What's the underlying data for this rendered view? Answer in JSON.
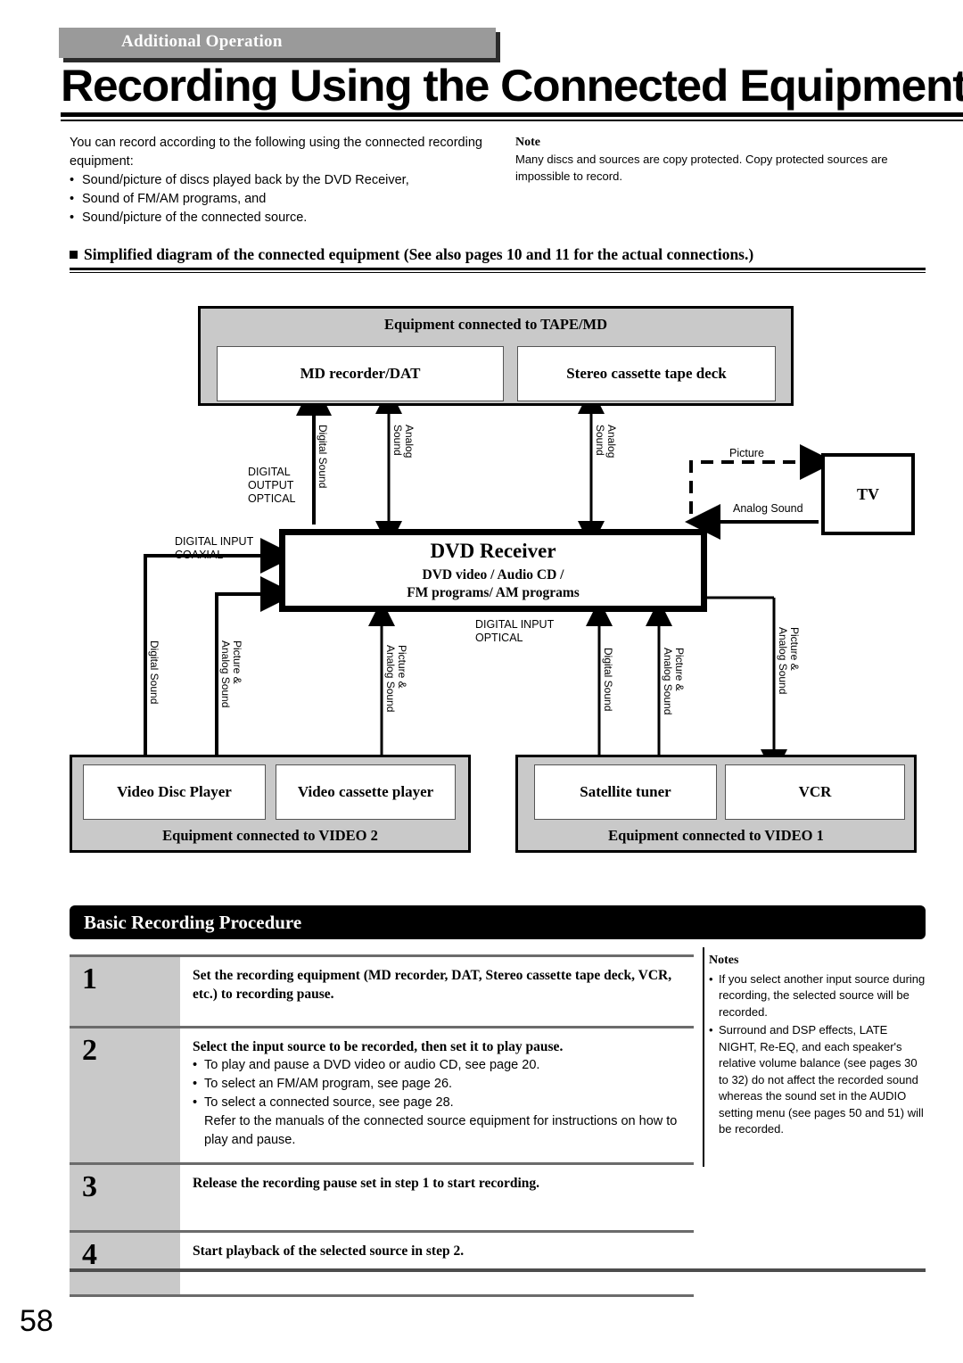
{
  "header": {
    "category_tab": "Additional Operation",
    "title": "Recording Using the Connected Equipment"
  },
  "intro": {
    "lead": "You can record according to the following using the connected recording equipment:",
    "bullets": [
      "Sound/picture of discs played back by the DVD Receiver,",
      "Sound of FM/AM programs, and",
      "Sound/picture of the connected source."
    ]
  },
  "note_top": {
    "heading": "Note",
    "text": "Many discs and sources are copy protected. Copy protected sources are impossible to record."
  },
  "section": {
    "heading": "Simplified diagram of the connected equipment (See also pages 10 and 11 for the actual connections.)"
  },
  "diagram": {
    "tape_md_group_title": "Equipment connected to TAPE/MD",
    "md_recorder": "MD recorder/DAT",
    "cassette_deck": "Stereo cassette tape deck",
    "receiver_name": "DVD Receiver",
    "receiver_sub_line1": "DVD video / Audio CD /",
    "receiver_sub_line2": "FM programs/ AM programs",
    "tv": "TV",
    "video2_group_title": "Equipment connected to VIDEO 2",
    "video_disc_player": "Video Disc Player",
    "video_cassette_player": "Video cassette player",
    "video1_group_title": "Equipment connected to VIDEO 1",
    "satellite_tuner": "Satellite tuner",
    "vcr": "VCR",
    "ports": {
      "digital_output_optical": "DIGITAL\nOUTPUT\nOPTICAL",
      "digital_input_coaxial": "DIGITAL INPUT\nCOAXIAL",
      "digital_input_optical": "DIGITAL INPUT\nOPTICAL"
    },
    "labels": {
      "digital_sound": "Digital Sound",
      "analog_sound_2line": "Analog\nSound",
      "picture": "Picture",
      "analog_sound": "Analog Sound",
      "picture_analog_2line": "Picture &\nAnalog Sound"
    }
  },
  "procedure": {
    "bar_title": "Basic Recording Procedure",
    "steps": [
      {
        "num": "1",
        "heading": "Set the recording equipment (MD recorder, DAT, Stereo cassette tape deck, VCR, etc.) to recording pause.",
        "bullets": [],
        "sub": ""
      },
      {
        "num": "2",
        "heading": "Select the input source to be recorded, then set it to play pause.",
        "bullets": [
          "To play and pause a DVD video or audio CD, see page 20.",
          "To select an FM/AM program, see page 26.",
          "To select a connected source, see page 28."
        ],
        "sub": "Refer to the manuals of the connected source equipment for instructions on how to play and pause."
      },
      {
        "num": "3",
        "heading": "Release the recording pause set in step 1 to start recording.",
        "bullets": [],
        "sub": ""
      },
      {
        "num": "4",
        "heading": "Start playback of the selected source in step 2.",
        "bullets": [],
        "sub": ""
      }
    ]
  },
  "notes_bottom": {
    "heading": "Notes",
    "items": [
      "If you select another input source during recording, the selected source will be recorded.",
      "Surround and DSP effects, LATE NIGHT, Re-EQ, and each speaker's relative volume balance (see pages 30 to 32) do not affect the recorded sound whereas the sound set in the AUDIO setting menu (see pages 50 and 51) will be recorded."
    ]
  },
  "footer": {
    "page_number": "58"
  }
}
